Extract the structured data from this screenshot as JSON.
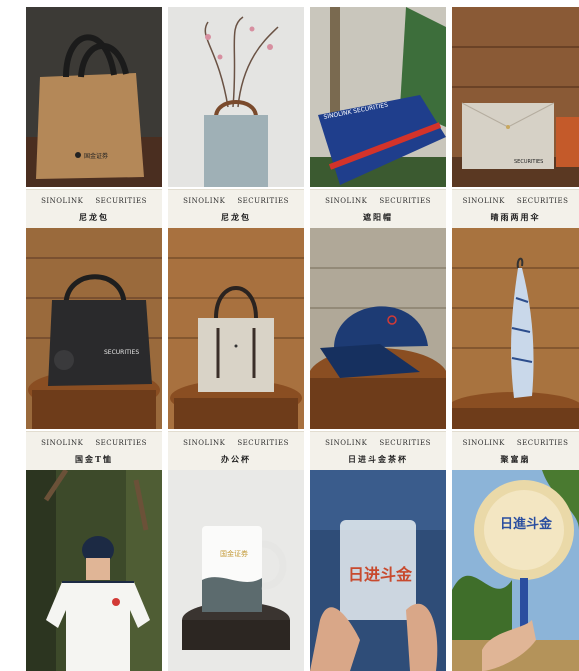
{
  "brand": {
    "left": "SINOLINK",
    "right": "SECURITIES"
  },
  "rows": [
    [
      {
        "product": "",
        "logo_text": "国金证券"
      },
      {
        "product": ""
      },
      {
        "product": "",
        "logo_text": "SINOLINK SECURITIES"
      },
      {
        "product": "",
        "logo_text": "SECURITIES"
      }
    ],
    [
      {
        "product": "尼龙包",
        "logo_text": "SECURITIES"
      },
      {
        "product": "尼龙包"
      },
      {
        "product": "遮阳帽"
      },
      {
        "product": "晴雨两用伞"
      }
    ],
    [
      {
        "product": "国金T恤"
      },
      {
        "product": "办公杯",
        "logo_text": "国金证券"
      },
      {
        "product": "日进斗金茶杯",
        "logo_text": "日进斗金"
      },
      {
        "product": "聚富扇",
        "logo_text": "日進斗金"
      }
    ]
  ]
}
